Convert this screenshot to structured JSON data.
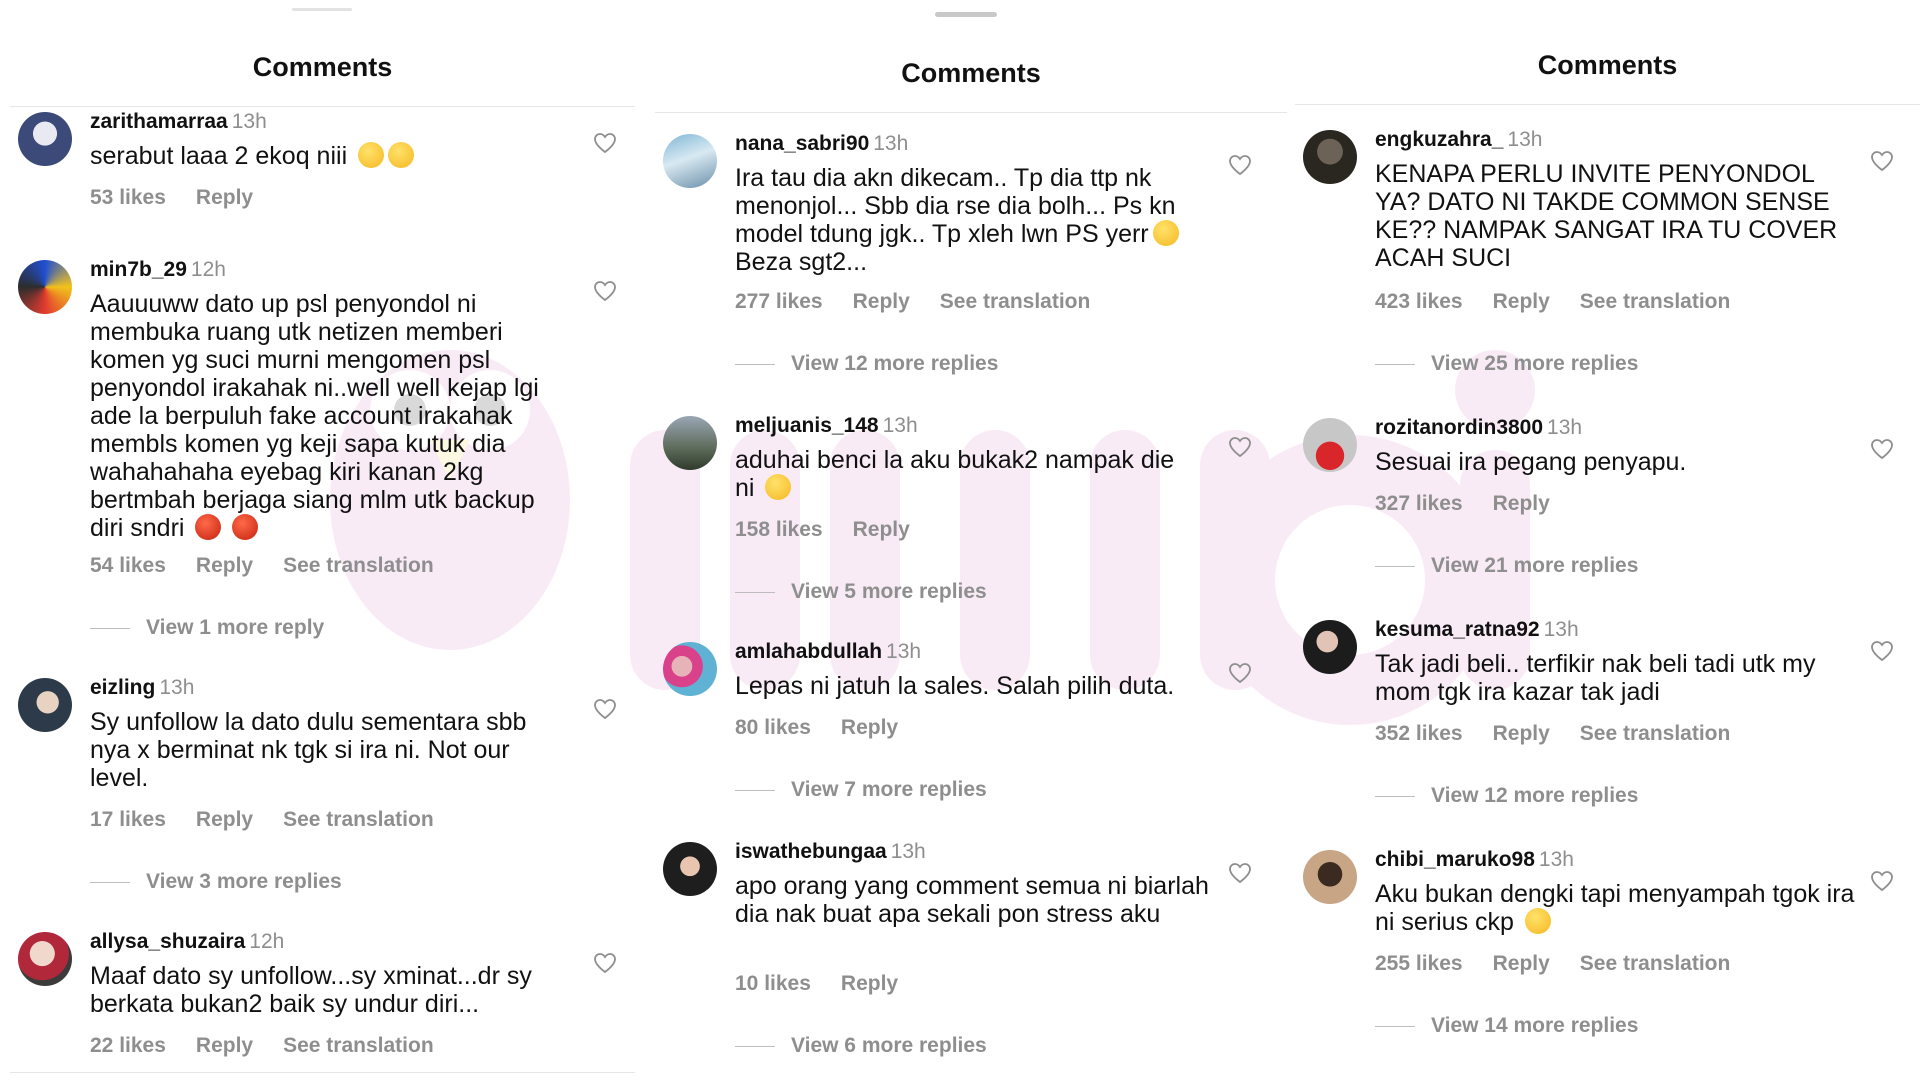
{
  "panels": [
    {
      "header": "Comments",
      "comments": [
        {
          "user": "zarithamarraa",
          "time": "13h",
          "text": "serabut laaa 2 ekoq niii",
          "emoji": [
            "yellow",
            "yellow"
          ],
          "likes": "53 likes",
          "reply": "Reply",
          "translation": ""
        },
        {
          "user": "min7b_29",
          "time": "12h",
          "text": "Aauuuww dato up psl penyondol ni membuka ruang utk netizen memberi komen yg suci murni mengomen psl penyondol irakahak ni..well well kejap lgi ade la berpuluh fake account irakahak membls komen yg keji sapa kutuk dia wahahahaha eyebag kiri kanan 2kg bertmbah berjaga siang mlm  utk backup diri sndri",
          "emoji": [
            "red",
            "red"
          ],
          "likes": "54 likes",
          "reply": "Reply",
          "translation": "See translation",
          "more": "View 1 more reply"
        },
        {
          "user": "eizling",
          "time": "13h",
          "text": "Sy unfollow la dato dulu sementara sbb nya x berminat nk tgk si ira ni. Not our level.",
          "emoji": [],
          "likes": "17 likes",
          "reply": "Reply",
          "translation": "See translation",
          "more": "View 3 more replies"
        },
        {
          "user": "allysa_shuzaira",
          "time": "12h",
          "text": "Maaf dato sy unfollow...sy xminat...dr sy berkata bukan2 baik sy undur diri...",
          "emoji": [],
          "likes": "22 likes",
          "reply": "Reply",
          "translation": "See translation"
        }
      ]
    },
    {
      "header": "Comments",
      "comments": [
        {
          "user": "nana_sabri90",
          "time": "13h",
          "text": "Ira tau dia akn dikecam.. Tp dia ttp nk menonjol... Sbb dia rse dia bolh... Ps kn model tdung jgk.. Tp xleh lwn PS yerr",
          "emoji": [
            "yellow"
          ],
          "text2": "Beza sgt2...",
          "likes": "277 likes",
          "reply": "Reply",
          "translation": "See translation",
          "more": "View 12 more replies"
        },
        {
          "user": "meljuanis_148",
          "time": "13h",
          "text": "aduhai benci la aku bukak2 nampak die ni",
          "emoji": [
            "yellow"
          ],
          "likes": "158 likes",
          "reply": "Reply",
          "translation": "",
          "more": "View 5 more replies"
        },
        {
          "user": "amlahabdullah",
          "time": "13h",
          "text": "Lepas ni jatuh la sales. Salah pilih duta.",
          "emoji": [],
          "likes": "80 likes",
          "reply": "Reply",
          "translation": "",
          "more": "View 7 more replies"
        },
        {
          "user": "iswathebungaa",
          "time": "13h",
          "text": "apo orang yang comment semua ni biarlah dia nak buat apa sekali pon stress aku",
          "emoji": [],
          "likes": "10 likes",
          "reply": "Reply",
          "translation": "",
          "more": "View 6 more replies"
        }
      ]
    },
    {
      "header": "Comments",
      "comments": [
        {
          "user": "engkuzahra_",
          "time": "13h",
          "text": "KENAPA PERLU INVITE PENYONDOL YA? DATO NI TAKDE COMMON SENSE KE?? NAMPAK SANGAT IRA TU COVER ACAH SUCI",
          "emoji": [],
          "likes": "423 likes",
          "reply": "Reply",
          "translation": "See translation",
          "more": "View 25 more replies"
        },
        {
          "user": "rozitanordin3800",
          "time": "13h",
          "text": "Sesuai ira pegang penyapu.",
          "emoji": [],
          "likes": "327 likes",
          "reply": "Reply",
          "translation": "",
          "more": "View 21 more replies"
        },
        {
          "user": "kesuma_ratna92",
          "time": "13h",
          "text": "Tak jadi beli.. terfikir nak beli tadi utk my mom tgk ira kazar tak jadi",
          "emoji": [],
          "likes": "352 likes",
          "reply": "Reply",
          "translation": "See translation",
          "more": "View 12 more replies"
        },
        {
          "user": "chibi_maruko98",
          "time": "13h",
          "text": "Aku bukan dengki tapi menyampah tgok ira ni serius ckp",
          "emoji": [
            "yellow"
          ],
          "likes": "255 likes",
          "reply": "Reply",
          "translation": "See translation",
          "more": "View 14 more replies"
        }
      ]
    }
  ],
  "icons": {
    "like": "heart-outline-icon"
  },
  "colors": {
    "text": "#111111",
    "muted": "#8e8e8e",
    "divider": "#e6e6e6",
    "watermark": "#e7a6d9"
  }
}
